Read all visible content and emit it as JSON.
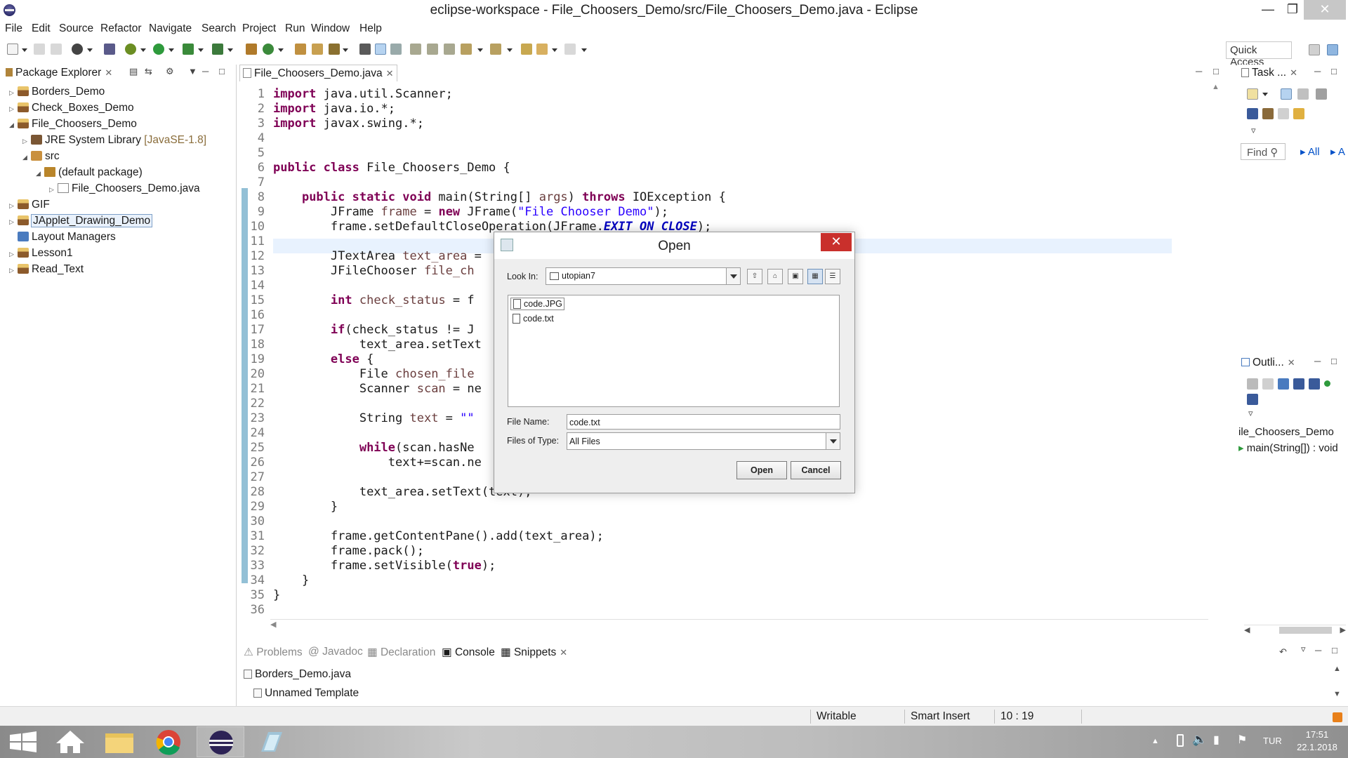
{
  "window": {
    "title": "eclipse-workspace - File_Choosers_Demo/src/File_Choosers_Demo.java - Eclipse"
  },
  "menu": [
    "File",
    "Edit",
    "Source",
    "Refactor",
    "Navigate",
    "Search",
    "Project",
    "Run",
    "Window",
    "Help"
  ],
  "toolbar": {
    "quick_access": "Quick Access"
  },
  "package_explorer": {
    "title": "Package Explorer",
    "items": [
      {
        "label": "Borders_Demo"
      },
      {
        "label": "Check_Boxes_Demo"
      },
      {
        "label": "File_Choosers_Demo"
      },
      {
        "label": "JRE System Library",
        "hint": "[JavaSE-1.8]"
      },
      {
        "label": "src"
      },
      {
        "label": "(default package)"
      },
      {
        "label": "File_Choosers_Demo.java"
      },
      {
        "label": "GIF"
      },
      {
        "label": "JApplet_Drawing_Demo"
      },
      {
        "label": "Layout Managers"
      },
      {
        "label": "Lesson1"
      },
      {
        "label": "Read_Text"
      }
    ]
  },
  "editor": {
    "tab": "File_Choosers_Demo.java",
    "line_numbers": [
      "1",
      "2",
      "3",
      "4",
      "5",
      "6",
      "7",
      "8",
      "9",
      "10",
      "11",
      "12",
      "13",
      "14",
      "15",
      "16",
      "17",
      "18",
      "19",
      "20",
      "21",
      "22",
      "23",
      "24",
      "25",
      "26",
      "27",
      "28",
      "29",
      "30",
      "31",
      "32",
      "33",
      "34",
      "35",
      "36"
    ],
    "code": {
      "l1_kw": "import",
      "l1_rest": " java.util.Scanner;",
      "l2_kw": "import",
      "l2_rest": " java.io.*;",
      "l3_kw": "import",
      "l3_rest": " javax.swing.*;",
      "l6_kw": "public class",
      "l6_rest": " File_Choosers_Demo {",
      "l8_kw1": "public static void",
      "l8_mid": " main(String[] ",
      "l8_var": "args",
      "l8_sp": ") ",
      "l8_kw2": "throws",
      "l8_rest": " IOException {",
      "l9_a": "JFrame ",
      "l9_var": "frame",
      "l9_b": " = ",
      "l9_kw": "new",
      "l9_c": " JFrame(",
      "l9_str": "\"File Chooser Demo\"",
      "l9_d": ");",
      "l10_a": "frame.setDefaultCloseOperation(JFrame.",
      "l10_fld": "EXIT_ON_CLOSE",
      "l10_b": ");",
      "l12_a": "JTextArea ",
      "l12_var": "text_area",
      "l12_b": " =",
      "l13_a": "JFileChooser ",
      "l13_var": "file_ch",
      "l15_kw": "int",
      "l15_sp": " ",
      "l15_var": "check_status",
      "l15_b": " = f",
      "l17_kw": "if",
      "l17_b": "(check_status != J",
      "l18_a": "text_area.setText",
      "l19_kw": "else",
      "l19_b": " {",
      "l20_a": "File ",
      "l20_var": "chosen_file",
      "l21_a": "Scanner ",
      "l21_var": "scan",
      "l21_b": " = ne",
      "l23_a": "String ",
      "l23_var": "text",
      "l23_b": " = ",
      "l23_str": "\"\"",
      "l25_kw": "while",
      "l25_b": "(scan.hasNe",
      "l26_a": "text+=scan.ne",
      "l28_a": "text_area.setText(text);",
      "l29_a": "}",
      "l31_a": "frame.getContentPane().add(text_area);",
      "l32_a": "frame.pack();",
      "l33_a": "frame.setVisible(",
      "l33_kw": "true",
      "l33_b": ");",
      "l34_a": "}",
      "l35_a": "}"
    }
  },
  "task_view": {
    "title": "Task ...",
    "find": "Find",
    "all": "All",
    "a": "A"
  },
  "outline_view": {
    "title": "Outli...",
    "class_name": "ile_Choosers_Demo",
    "method": "main(String[]) : void"
  },
  "bottom_panel": {
    "tabs": [
      "Problems",
      "Javadoc",
      "Declaration",
      "Console",
      "Snippets"
    ],
    "items": [
      "Borders_Demo.java",
      "Unnamed Template"
    ]
  },
  "statusbar": {
    "writable": "Writable",
    "insert_mode": "Smart Insert",
    "position": "10 : 19"
  },
  "taskbar": {
    "lang": "TUR",
    "time": "17:51",
    "date": "22.1.2018"
  },
  "open_dialog": {
    "title": "Open",
    "look_in_label": "Look In:",
    "look_in_value": "utopian7",
    "files": [
      "code.JPG",
      "code.txt"
    ],
    "file_name_label": "File Name:",
    "file_name_value": "code.txt",
    "files_of_type_label": "Files of Type:",
    "files_of_type_value": "All Files",
    "open_button": "Open",
    "cancel_button": "Cancel"
  },
  "colors": {
    "keyword": "#7f0055",
    "string": "#2a00ff",
    "field": "#0000c0",
    "line_highlight": "#e8f2fe",
    "close_red": "#c9302c"
  }
}
